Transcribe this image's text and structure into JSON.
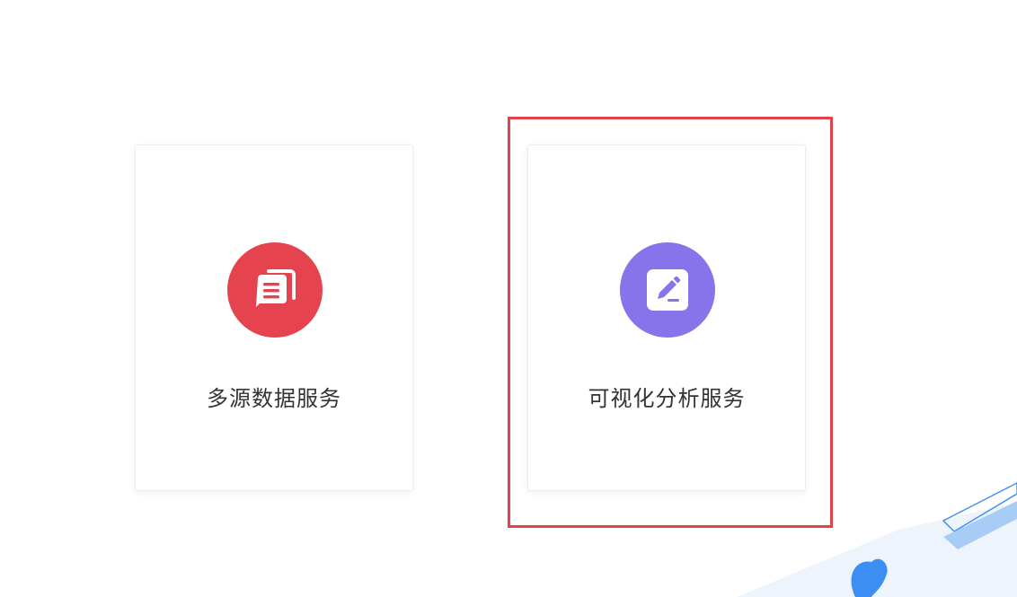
{
  "cards": [
    {
      "label": "多源数据服务",
      "icon": "document-stack-icon",
      "icon_bg": "#e5444f"
    },
    {
      "label": "可视化分析服务",
      "icon": "edit-icon",
      "icon_bg": "#8774ea"
    }
  ],
  "colors": {
    "highlight": "#e34248",
    "decoration_blue": "#3c8ef2"
  }
}
